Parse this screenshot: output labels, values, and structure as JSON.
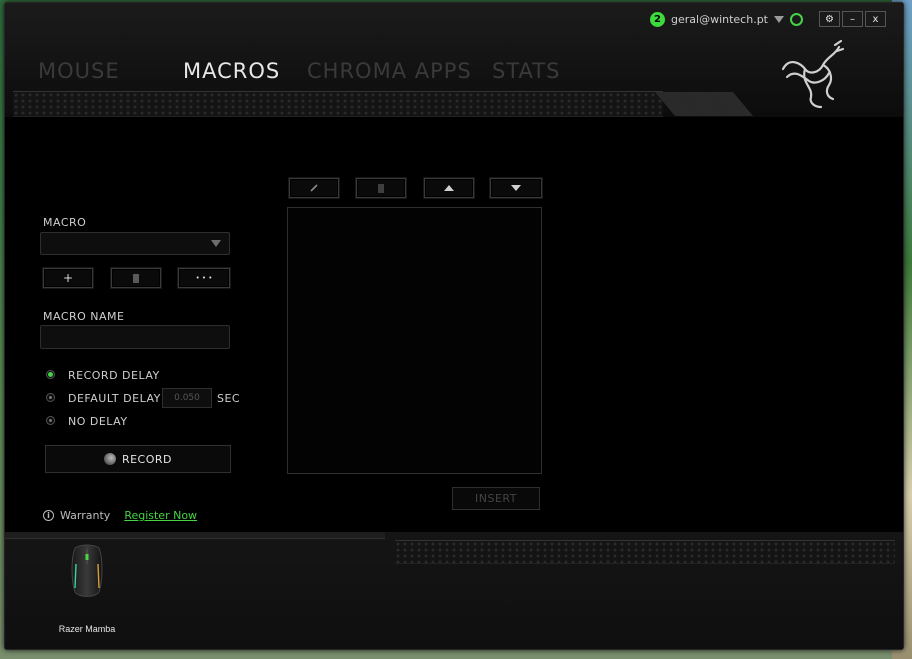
{
  "account": {
    "notifications": "2",
    "email": "geral@wintech.pt"
  },
  "window_controls": {
    "settings": "⚙",
    "minimize": "–",
    "close": "x"
  },
  "tabs": [
    {
      "label": "MOUSE",
      "active": false
    },
    {
      "label": "MACROS",
      "active": true
    },
    {
      "label": "CHROMA APPS",
      "active": false
    },
    {
      "label": "STATS",
      "active": false
    }
  ],
  "macro": {
    "section_label": "MACRO",
    "selected": "",
    "add_label": "+",
    "delete_label": "",
    "more_label": "• • •",
    "name_label": "MACRO NAME",
    "name_value": ""
  },
  "delay": {
    "options": [
      {
        "label": "RECORD DELAY",
        "selected": true
      },
      {
        "label": "DEFAULT DELAY",
        "selected": false
      },
      {
        "label": "NO DELAY",
        "selected": false
      }
    ],
    "default_value": "0.050",
    "unit": "SEC"
  },
  "record_label": "RECORD",
  "insert_label": "INSERT",
  "warranty": {
    "label": "Warranty",
    "link": "Register Now"
  },
  "device": {
    "name": "Razer Mamba"
  },
  "colors": {
    "accent": "#44d444",
    "background": "#000000"
  }
}
